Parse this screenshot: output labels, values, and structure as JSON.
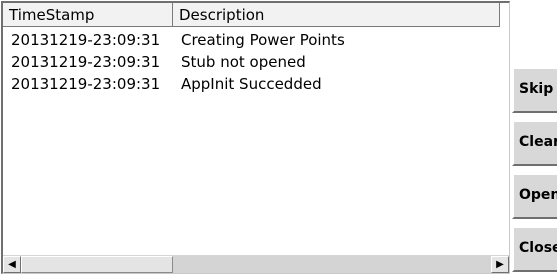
{
  "log_table": {
    "columns": [
      "TimeStamp",
      "Description"
    ],
    "rows": [
      {
        "timestamp": "20131219-23:09:31",
        "description": "Creating Power Points"
      },
      {
        "timestamp": "20131219-23:09:31",
        "description": "Stub not opened"
      },
      {
        "timestamp": "20131219-23:09:31",
        "description": "AppInit Succedded"
      }
    ]
  },
  "scrollbar": {
    "left_arrow": "◀",
    "right_arrow": "▶"
  },
  "buttons": {
    "skip": "Skip",
    "clear": "Clear",
    "open": "Open",
    "close": "Close"
  }
}
